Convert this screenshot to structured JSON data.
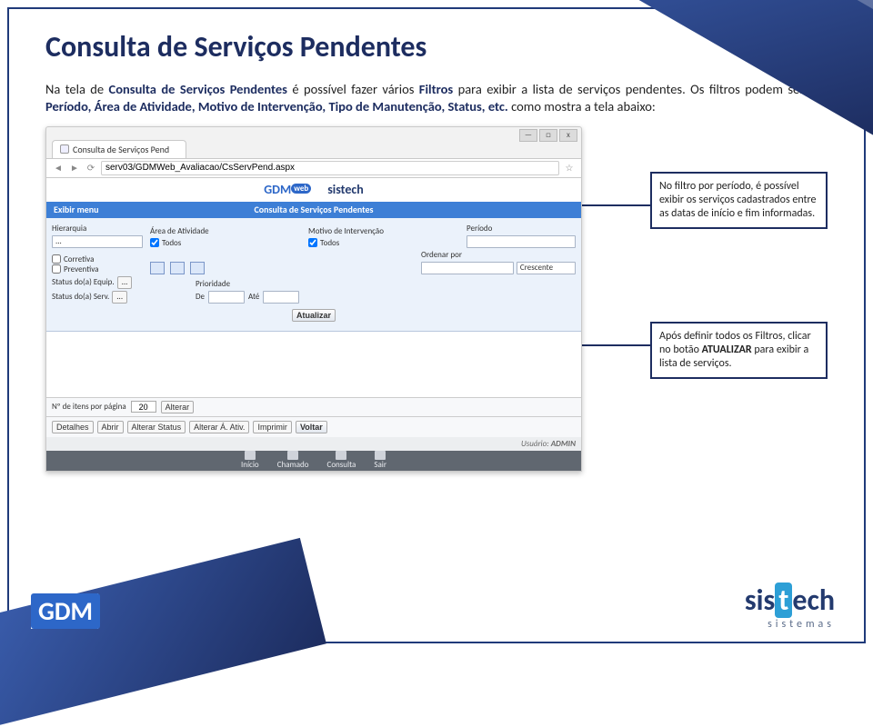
{
  "title": "Consulta de Serviços Pendentes",
  "paragraph": {
    "pre": "Na tela de ",
    "kw1": "Consulta de Serviços Pendentes",
    "mid1": " é possível fazer vários ",
    "kw2": "Filtros",
    "mid2": " para exibir a lista de serviços pendentes. Os filtros podem ser por ",
    "kw3": "Período, Área de Atividade, Motivo de Intervenção, Tipo de Manutenção, Status, etc.",
    "tail": " como mostra a tela abaixo:"
  },
  "callouts": {
    "c1": "No filtro por período, é possível exibir os serviços cadastrados entre as datas de início e fim informadas.",
    "c2_pre": "Após definir todos os Filtros, clicar no botão ",
    "c2_kw": "ATUALIZAR",
    "c2_post": " para exibir a lista de serviços."
  },
  "browser": {
    "tab_title": "Consulta de Serviços Pend",
    "url": "serv03/GDMWeb_Avaliacao/CsServPend.aspx",
    "window": {
      "min": "—",
      "max": "□",
      "close": "x"
    }
  },
  "app": {
    "brand_gdm": "GDM",
    "brand_gdm_tag": "web",
    "brand_sis": "sistech",
    "menu_left": "Exibir menu",
    "page_header": "Consulta de Serviços Pendentes",
    "filters": {
      "hierarquia": "Hierarquia",
      "area": "Área de Atividade",
      "area_chk": "Todos",
      "motivo": "Motivo de Intervenção",
      "motivo_chk": "Todos",
      "periodo": "Período",
      "corretiva": "Corretiva",
      "preventiva": "Preventiva",
      "ordenar": "Ordenar por",
      "ordenar_val": "Crescente",
      "status_equip": "Status do(a) Equip.",
      "status_serv": "Status do(a) Serv.",
      "prioridade": "Prioridade",
      "de": "De",
      "ate": "Até",
      "dots": "...",
      "atualizar": "Atualizar"
    },
    "footer": {
      "itens_label": "Nº de itens por página",
      "itens_val": "20",
      "alterar": "Alterar"
    },
    "buttons": {
      "detalhes": "Detalhes",
      "abrir": "Abrir",
      "alterar_status": "Alterar Status",
      "alterar_ativ": "Alterar Á. Ativ.",
      "imprimir": "Imprimir",
      "voltar": "Voltar"
    },
    "user_label": "Usuário: ",
    "user_value": "ADMIN",
    "nav": {
      "inicio": "Início",
      "chamado": "Chamado",
      "consulta": "Consulta",
      "sair": "Sair"
    }
  },
  "logos": {
    "gdm": "GDM",
    "sis_pre": "sis",
    "sis_t": "t",
    "sis_post": "ech",
    "sis_sub": "sistemas"
  }
}
